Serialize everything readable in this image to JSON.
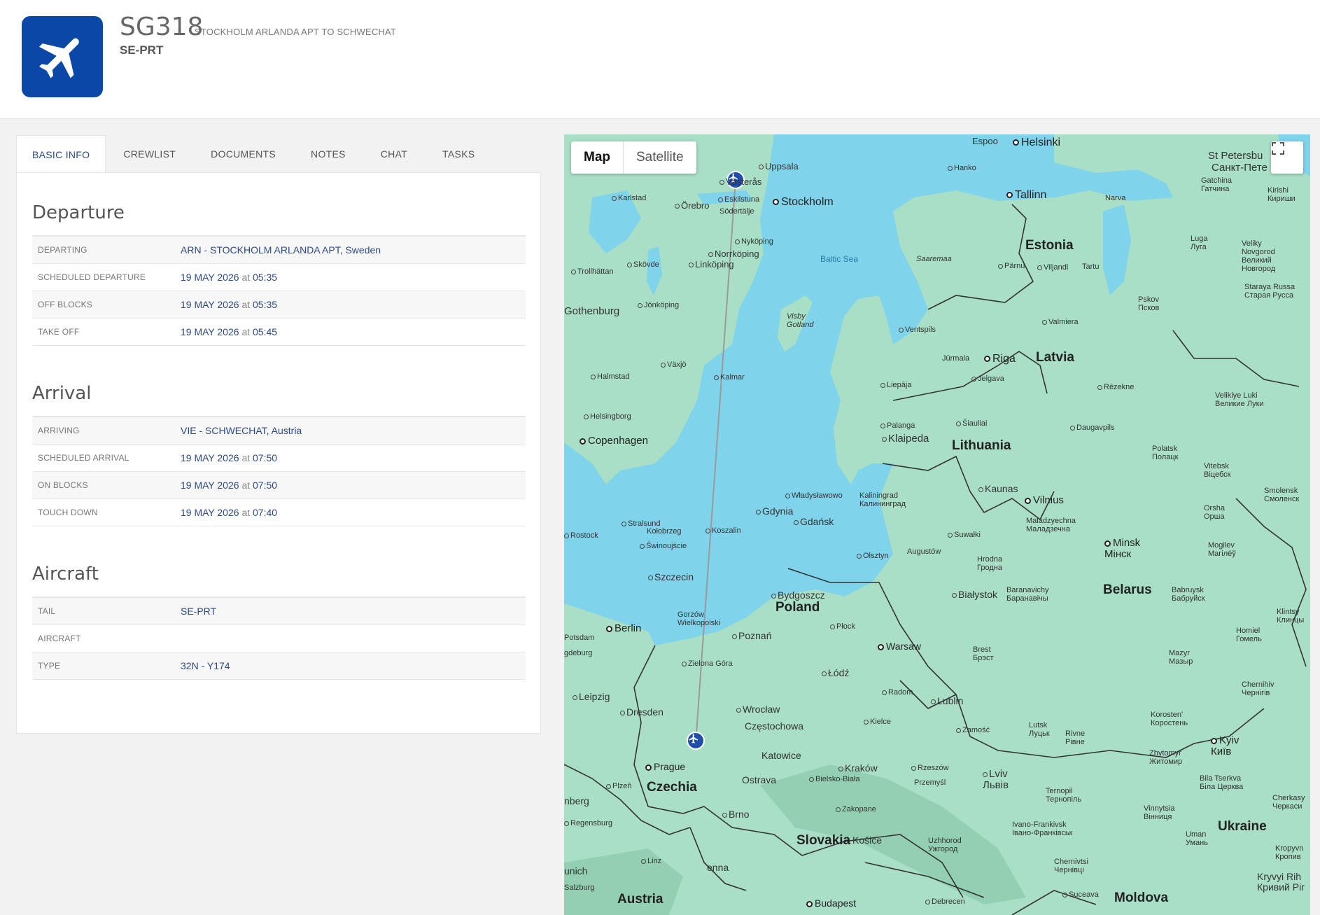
{
  "header": {
    "flight_number": "SG318",
    "route": "STOCKHOLM ARLANDA APT TO SCHWECHAT",
    "registration": "SE-PRT",
    "logo_icon": "airplane-icon",
    "logo_color": "#0a48a8"
  },
  "tabs": [
    {
      "label": "BASIC INFO",
      "active": true
    },
    {
      "label": "CREWLIST"
    },
    {
      "label": "DOCUMENTS"
    },
    {
      "label": "NOTES"
    },
    {
      "label": "CHAT"
    },
    {
      "label": "TASKS"
    }
  ],
  "departure": {
    "title": "Departure",
    "rows": [
      {
        "label": "DEPARTING",
        "value": "ARN - STOCKHOLM ARLANDA APT, Sweden"
      },
      {
        "label": "SCHEDULED DEPARTURE",
        "date": "19 MAY 2026",
        "at": "at",
        "time": "05:35"
      },
      {
        "label": "OFF BLOCKS",
        "date": "19 MAY 2026",
        "at": "at",
        "time": "05:35"
      },
      {
        "label": "TAKE OFF",
        "date": "19 MAY 2026",
        "at": "at",
        "time": "05:45"
      }
    ]
  },
  "arrival": {
    "title": "Arrival",
    "rows": [
      {
        "label": "ARRIVING",
        "value": "VIE - SCHWECHAT, Austria"
      },
      {
        "label": "SCHEDULED ARRIVAL",
        "date": "19 MAY 2026",
        "at": "at",
        "time": "07:50"
      },
      {
        "label": "ON BLOCKS",
        "date": "19 MAY 2026",
        "at": "at",
        "time": "07:50"
      },
      {
        "label": "TOUCH DOWN",
        "date": "19 MAY 2026",
        "at": "at",
        "time": "07:40"
      }
    ]
  },
  "aircraft": {
    "title": "Aircraft",
    "rows": [
      {
        "label": "TAIL",
        "value": "SE-PRT"
      },
      {
        "label": "AIRCRAFT",
        "value": ""
      },
      {
        "label": "TYPE",
        "value": "32N - Y174"
      }
    ]
  },
  "map": {
    "type_map": "Map",
    "type_satellite": "Satellite",
    "fullscreen_icon": "fullscreen-icon",
    "water_color": "#7fd3ea",
    "land_color": "#a9dfc7",
    "labels": {
      "espoo": "Espoo",
      "helsinki": "Helsinki",
      "hanko": "Hanko",
      "st_petersburg": "St Petersbu",
      "st_petersburg_ru": "Санкт-Пете",
      "gatchina": "Gatchina\nГатчина",
      "kirishi": "Kirishi\nКириши",
      "uppsala": "Uppsala",
      "vasteras": "Västerås",
      "karlstad": "Karlstad",
      "orebro": "Örebro",
      "eskilstuna": "Eskilstuna",
      "sodertalje": "Södertälje",
      "stockholm": "Stockholm",
      "tallinn": "Tallinn",
      "narva": "Narva",
      "luga": "Luga\nЛуга",
      "novgorod": "Veliky\nNovgorod\nВеликий\nНовгород",
      "nykoping": "Nyköping",
      "norrkoping": "Norrköping",
      "linkoping": "Linköping",
      "skovde": "Skövde",
      "trollhattan": "Trollhättan",
      "baltic_sea": "Baltic Sea",
      "saaremaa": "Saaremaa",
      "estonia": "Estonia",
      "parnu": "Pärnu",
      "viljandi": "Viljandi",
      "tartu": "Tartu",
      "staraya_russa": "Staraya Russa\nСтарая Русса",
      "pskov": "Pskov\nПсков",
      "gothenburg": "Gothenburg",
      "jonkoping": "Jönköping",
      "visby": "Visby\nGotland",
      "valmiera": "Valmiera",
      "ventspils": "Ventspils",
      "jurmala": "Jūrmala",
      "riga": "Riga",
      "latvia": "Latvia",
      "vaxjo": "Växjö",
      "halmstad": "Halmstad",
      "kalmar": "Kalmar",
      "liepaja": "Liepāja",
      "jelgava": "Jelgava",
      "rezekne": "Rēzekne",
      "velikiye_luki": "Velikiye Luki\nВеликие Луки",
      "helsingborg": "Helsingborg",
      "copenhagen": "Copenhagen",
      "palanga": "Palanga",
      "siauliai": "Šiauliai",
      "klaipeda": "Klaipeda",
      "lithuania": "Lithuania",
      "daugavpils": "Daugavpils",
      "polatsk": "Polatsk\nПолацк",
      "vitebsk": "Vitebsk\nВіцебск",
      "smolensk": "Smolensk\nСмоленск",
      "kaunas": "Kaunas",
      "vilnius": "Vilnius",
      "wladyslawowo": "Władysławowo",
      "kaliningrad": "Kaliningrad\nКалининград",
      "gdynia": "Gdynia",
      "gdansk": "Gdańsk",
      "stralsund": "Stralsund",
      "rostock": "Rostock",
      "kolobrzeg": "Kołobrzeg",
      "koszalin": "Koszalin",
      "swinoujscie": "Świnoujście",
      "suwalki": "Suwałki",
      "olsztyn": "Olsztyn",
      "augustow": "Augustów",
      "hrodna": "Hrodna\nГродна",
      "maladzyechna": "Maladzyechna\nМаладзечна",
      "minsk": "Minsk\nМінск",
      "orsha": "Orsha\nОрша",
      "mogilev": "Mogilev\nMaгілёў",
      "szczecin": "Szczecin",
      "bydgoszcz": "Bydgoszcz",
      "poland": "Poland",
      "bialystok": "Białystok",
      "baranavichy": "Baranavichy\nБаранавічы",
      "belarus": "Belarus",
      "babruysk": "Babruysk\nБабруйск",
      "klintsy": "Klintsy\nКлинцы",
      "gorzow": "Gorzów\nWielkopolski",
      "berlin": "Berlin",
      "potsdam": "Potsdam",
      "poznan": "Poznań",
      "plock": "Płock",
      "warsaw": "Warsaw",
      "brest": "Brest\nБрэст",
      "homiel": "Homiel\nГомель",
      "mazyr": "Mazyr\nМазыр",
      "magdeburg": "gdeburg",
      "zielona_gora": "Zielona Góra",
      "lodz": "Łódź",
      "chernihiv": "Chernihiv\nЧернігів",
      "leipzig": "Leipzig",
      "radom": "Radom",
      "lublin": "Lublin",
      "dresden": "Dresden",
      "wroclaw": "Wrocław",
      "czestochowa": "Częstochowa",
      "kielce": "Kielce",
      "zamosc": "Zamość",
      "korosten": "Korosten'\nКоростень",
      "lutsk": "Lutsk\nЛуцьк",
      "rivne": "Rivne\nРівне",
      "kyiv": "Kyiv\nКиїв",
      "katowice": "Katowice",
      "krakow": "Kraków",
      "rzeszow": "Rzeszów",
      "prague": "Prague",
      "zhytomyr": "Zhytomyr\nЖитомир",
      "plzen": "Plzeň",
      "czechia": "Czechia",
      "ostrava": "Ostrava",
      "bielsko": "Bielsko-Biała",
      "przemysl": "Przemyśl",
      "lviv": "Lviv\nЛьвів",
      "ternopil": "Ternopil\nТернопіль",
      "bila_tserkva": "Bila Tserkva\nБіла Церква",
      "cherkasy": "Cherkasy\nЧеркаси",
      "bamberg": "nberg",
      "regensburg": "Regensburg",
      "brno": "Brno",
      "zakopane": "Zakopane",
      "vinnytsia": "Vinnytsia\nВінниця",
      "slovakia": "Slovakia",
      "kosice": "Košice",
      "uzhhorod": "Uzhhorod\nУжгород",
      "ivano": "Ivano-Frankivsk\nІвано-Франківськ",
      "uman": "Uman\nУмань",
      "ukraine": "Ukraine",
      "kropyvnytskyi": "Kropyvn\nКропив",
      "linz": "Linz",
      "vienna": "enna",
      "munich": "unich",
      "salzburg": "Salzburg",
      "chernivtsi": "Chernivtsi\nЧернівці",
      "kryvyi_rih": "Kryvyi Rih\nКривий Ріг",
      "austria": "Austria",
      "budapest": "Budapest",
      "debrecen": "Debrecen",
      "suceava": "Suceava",
      "moldova": "Moldova"
    }
  }
}
